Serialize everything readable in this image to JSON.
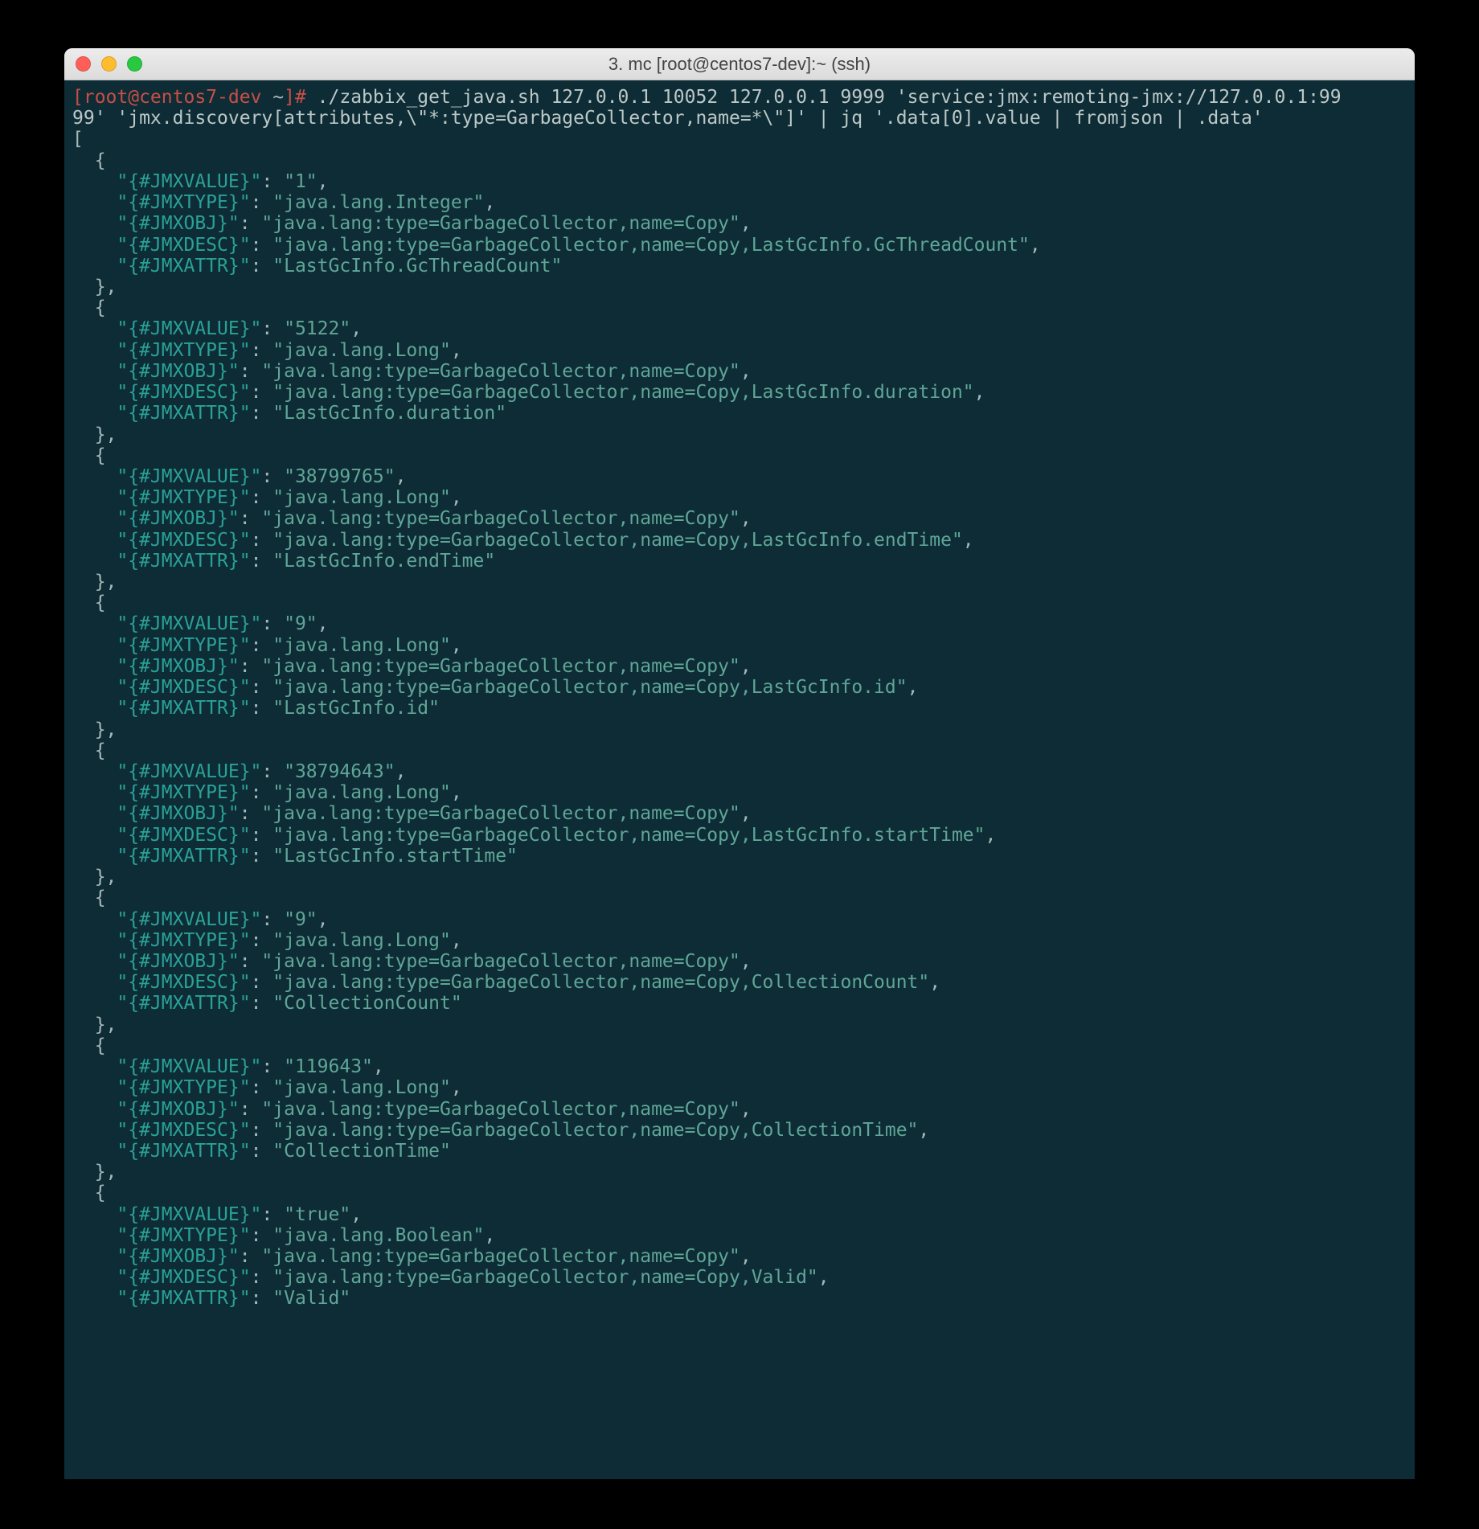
{
  "window": {
    "title": "3. mc [root@centos7-dev]:~ (ssh)"
  },
  "prompt": {
    "user": "[root@centos7-dev ",
    "tilde": "~",
    "bracket": "]",
    "hash": "# "
  },
  "command_line1": "./zabbix_get_java.sh 127.0.0.1 10052 127.0.0.1 9999 'service:jmx:remoting-jmx://127.0.0.1:99",
  "command_line2_a": "99' 'jmx.discovery[attributes,\\\"*:type=GarbageCollector,name=*\\\"]' | jq ",
  "command_line2_b": "'.data[0].value | fromjson | .data'",
  "json_open": "[",
  "entries": [
    {
      "value": "1",
      "type": "java.lang.Integer",
      "obj": "java.lang:type=GarbageCollector,name=Copy",
      "desc": "java.lang:type=GarbageCollector,name=Copy,LastGcInfo.GcThreadCount",
      "attr": "LastGcInfo.GcThreadCount"
    },
    {
      "value": "5122",
      "type": "java.lang.Long",
      "obj": "java.lang:type=GarbageCollector,name=Copy",
      "desc": "java.lang:type=GarbageCollector,name=Copy,LastGcInfo.duration",
      "attr": "LastGcInfo.duration"
    },
    {
      "value": "38799765",
      "type": "java.lang.Long",
      "obj": "java.lang:type=GarbageCollector,name=Copy",
      "desc": "java.lang:type=GarbageCollector,name=Copy,LastGcInfo.endTime",
      "attr": "LastGcInfo.endTime"
    },
    {
      "value": "9",
      "type": "java.lang.Long",
      "obj": "java.lang:type=GarbageCollector,name=Copy",
      "desc": "java.lang:type=GarbageCollector,name=Copy,LastGcInfo.id",
      "attr": "LastGcInfo.id"
    },
    {
      "value": "38794643",
      "type": "java.lang.Long",
      "obj": "java.lang:type=GarbageCollector,name=Copy",
      "desc": "java.lang:type=GarbageCollector,name=Copy,LastGcInfo.startTime",
      "attr": "LastGcInfo.startTime"
    },
    {
      "value": "9",
      "type": "java.lang.Long",
      "obj": "java.lang:type=GarbageCollector,name=Copy",
      "desc": "java.lang:type=GarbageCollector,name=Copy,CollectionCount",
      "attr": "CollectionCount"
    },
    {
      "value": "119643",
      "type": "java.lang.Long",
      "obj": "java.lang:type=GarbageCollector,name=Copy",
      "desc": "java.lang:type=GarbageCollector,name=Copy,CollectionTime",
      "attr": "CollectionTime"
    },
    {
      "value": "true",
      "type": "java.lang.Boolean",
      "obj": "java.lang:type=GarbageCollector,name=Copy",
      "desc": "java.lang:type=GarbageCollector,name=Copy,Valid",
      "attr": "Valid",
      "last": true
    }
  ],
  "keys": {
    "value": "{#JMXVALUE}",
    "type": "{#JMXTYPE}",
    "obj": "{#JMXOBJ}",
    "desc": "{#JMXDESC}",
    "attr": "{#JMXATTR}"
  }
}
